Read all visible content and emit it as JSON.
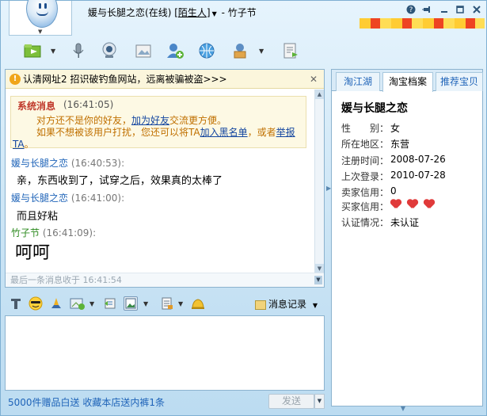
{
  "header": {
    "contact_name": "媛与长腿之恋",
    "status": "(在线)",
    "relation": "陌生人",
    "separator": "-",
    "self_name": "竹子节"
  },
  "window_controls": [
    "help-icon",
    "pin-icon",
    "minimize-icon",
    "maximize-icon",
    "close-icon"
  ],
  "toolbar": {
    "icons": [
      "send-file-icon",
      "voice-icon",
      "webcam-icon",
      "photo-icon",
      "add-friend-icon",
      "web-icon",
      "tools-icon",
      "notes-icon"
    ]
  },
  "warning": {
    "text": "认清网址2 招识破钓鱼网站，远离被骗被盗>>>",
    "close": "✕"
  },
  "system_message": {
    "title": "系统消息",
    "time": "(16:41:05)",
    "line1_a": "对方还不是你的好友，",
    "line1_link": "加为好友",
    "line1_b": "交流更方便。",
    "line2_a": "如果不想被该用户打扰，您还可以将TA",
    "line2_link1": "加入黑名单",
    "line2_b": "，或者",
    "line2_link2": "举报",
    "line3_link": "TA",
    "line3_b": "。"
  },
  "messages": [
    {
      "sender": "媛与长腿之恋",
      "time": "(16:40:53):",
      "text": "亲，东西收到了，试穿之后，效果真的太棒了"
    },
    {
      "sender": "媛与长腿之恋",
      "time": "(16:41:00):",
      "text": "而且好粘"
    },
    {
      "sender": "竹子节",
      "time": "(16:41:09):",
      "text": "呵呵"
    }
  ],
  "status_line": "最后一条消息收于 16:41:54",
  "input_toolbar": {
    "icons": [
      "font-icon",
      "emoticon-icon",
      "magic-icon",
      "screenshot-icon",
      "shake-icon",
      "image-icon",
      "memo-icon",
      "bell-icon"
    ],
    "history_label": "消息记录"
  },
  "footer": {
    "link": "5000件赠品白送 收藏本店送内裤1条",
    "send_label": "发送"
  },
  "right_panel": {
    "tabs": [
      "淘江湖",
      "淘宝档案",
      "推荐宝贝"
    ],
    "active_tab": "淘宝档案",
    "seller_name": "媛与长腿之恋",
    "info": [
      {
        "label": "性　　别：",
        "value": "女"
      },
      {
        "label": "所在地区：",
        "value": "东营"
      },
      {
        "label": "注册时间：",
        "value": "2008-07-26"
      },
      {
        "label": "上次登录：",
        "value": "2010-07-28"
      },
      {
        "label": "卖家信用：",
        "value": "0"
      },
      {
        "label": "买家信用：",
        "value": ""
      },
      {
        "label": "认证情况：",
        "value": "未认证"
      }
    ],
    "buyer_credit_hearts": 3
  },
  "colors": {
    "accent_blue": "#1e63b8",
    "sender_green": "#2e8b20",
    "system_red": "#c0392b",
    "system_orange": "#c07000"
  }
}
